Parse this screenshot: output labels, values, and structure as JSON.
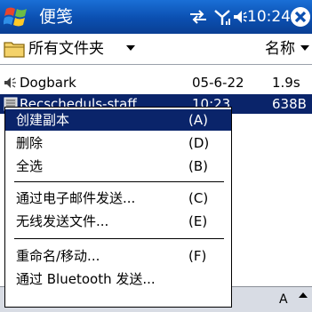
{
  "titlebar": {
    "title": "便笺",
    "clock": "10:24",
    "colors": {
      "bar": "#0b4fb0",
      "text": "#ffffff"
    },
    "icons": [
      "windows-start-flag",
      "sync-icon",
      "signal-icon",
      "volume-icon",
      "close-icon"
    ]
  },
  "folderbar": {
    "folder_label": "所有文件夹",
    "sort_label": "名称"
  },
  "files": [
    {
      "icon": "audio-file-icon",
      "name": "Dogbark",
      "date": "05-6-22",
      "size": "1.9s"
    },
    {
      "icon": "note-file-icon",
      "name": "Recscheduls-staff",
      "date": "10:23",
      "size": "638B"
    }
  ],
  "menu": {
    "items": [
      {
        "label": "创建副本",
        "key": "(A)",
        "selected": true
      },
      {
        "label": "删除",
        "key": "(D)"
      },
      {
        "label": "全选",
        "key": "(B)"
      },
      {
        "label": "通过电子邮件发送...",
        "key": "(C)"
      },
      {
        "label": "无线发送文件...",
        "key": "(E)"
      },
      {
        "label": "重命名/移动...",
        "key": "(F)"
      },
      {
        "label": "通过 Bluetooth 发送..."
      }
    ],
    "selection_color": "#0a246a"
  },
  "bottombar": {
    "input_label": "A"
  }
}
